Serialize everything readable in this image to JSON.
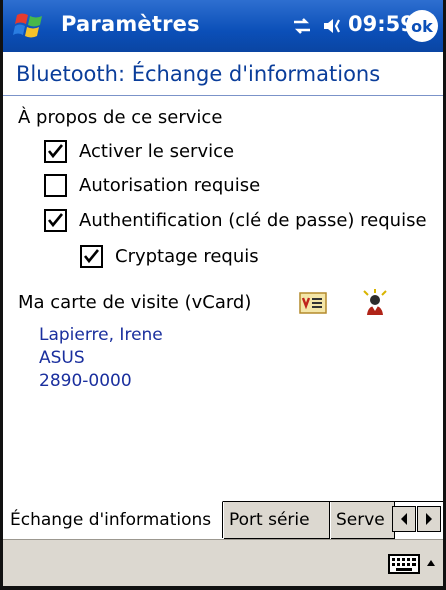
{
  "titlebar": {
    "app_title": "Paramètres",
    "clock": "09:59",
    "ok_label": "ok"
  },
  "header": {
    "title": "Bluetooth: Échange d'informations"
  },
  "content": {
    "about_label": "À propos de ce service",
    "options": [
      {
        "label": "Activer le service",
        "checked": true
      },
      {
        "label": "Autorisation requise",
        "checked": false
      },
      {
        "label": "Authentification (clé de passe) requise",
        "checked": true
      },
      {
        "label": "Cryptage requis",
        "checked": true
      }
    ],
    "vcard_label": "Ma carte de visite (vCard)",
    "vcard_lines": [
      "Lapierre, Irene",
      "ASUS",
      "2890-0000"
    ]
  },
  "tabs": [
    {
      "label": "Échange d'informations",
      "active": true
    },
    {
      "label": "Port série",
      "active": false
    },
    {
      "label": "Serve",
      "active": false
    }
  ],
  "colors": {
    "titlebar": "#0b4fb8",
    "header_text": "#0a3d9a",
    "card_text": "#1a2f9e",
    "command_bar": "#dcd8d0"
  },
  "icons": {
    "start": "windows-flag-icon",
    "connectivity": "connectivity-icon",
    "volume": "speaker-icon",
    "vcard": "vcard-icon",
    "contact": "contact-picker-icon",
    "keyboard": "keyboard-icon",
    "sip": "chevron-up-icon",
    "scroll_left": "chevron-left-icon",
    "scroll_right": "chevron-right-icon"
  }
}
